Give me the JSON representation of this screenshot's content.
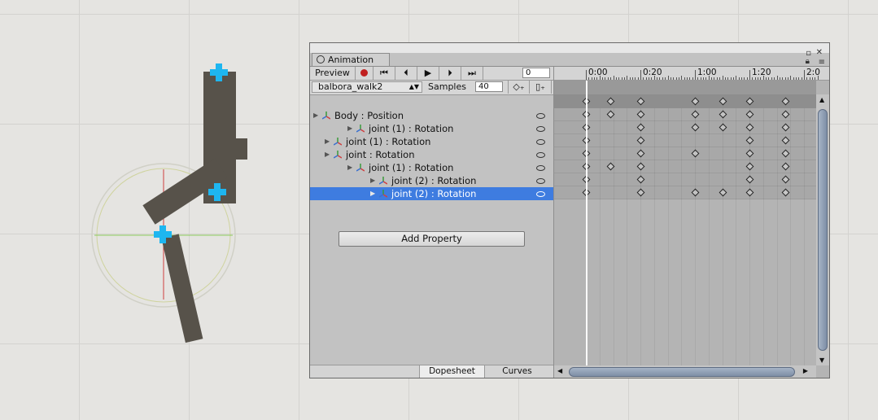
{
  "window": {
    "title": "Animation"
  },
  "toolbar": {
    "preview_label": "Preview",
    "record_icon": "record-icon",
    "first_key_icon": "skip-first-icon",
    "prev_key_icon": "step-back-icon",
    "play_icon": "play-icon",
    "next_key_icon": "step-forward-icon",
    "last_key_icon": "skip-last-icon",
    "frame_value": "0"
  },
  "clip": {
    "name": "balbora_walk2",
    "samples_label": "Samples",
    "samples_value": "40"
  },
  "properties": [
    {
      "label": "Body : Position",
      "expanded": false
    },
    {
      "label": "joint (1) : Rotation",
      "expanded": false
    },
    {
      "label": "joint (1) : Rotation",
      "expanded": false
    },
    {
      "label": "joint : Rotation",
      "expanded": false
    },
    {
      "label": "joint (1) : Rotation",
      "expanded": false
    },
    {
      "label": "joint (2) : Rotation",
      "expanded": false
    },
    {
      "label": "joint (2) : Rotation",
      "expanded": false,
      "selected": true
    }
  ],
  "add_property_label": "Add Property",
  "bottom_tabs": {
    "dopesheet": "Dopesheet",
    "curves": "Curves"
  },
  "timeline": {
    "ruler_labels": [
      "0:00",
      "0:20",
      "1:00",
      "1:20",
      "2:0"
    ],
    "summary_keys": [
      0,
      9,
      20,
      40,
      50,
      60,
      73
    ],
    "track_keys": [
      [
        0,
        9,
        20,
        40,
        50,
        60,
        73
      ],
      [
        0,
        20,
        40,
        50,
        60,
        73
      ],
      [
        0,
        20,
        60,
        73
      ],
      [
        0,
        20,
        40,
        60,
        73
      ],
      [
        0,
        9,
        20,
        60,
        73
      ],
      [
        0,
        20,
        60,
        73
      ],
      [
        0,
        20,
        40,
        50,
        60,
        73
      ]
    ]
  },
  "colors": {
    "selection": "#3e7ce0",
    "handle": "#1eb6f0",
    "record": "#c02020"
  }
}
